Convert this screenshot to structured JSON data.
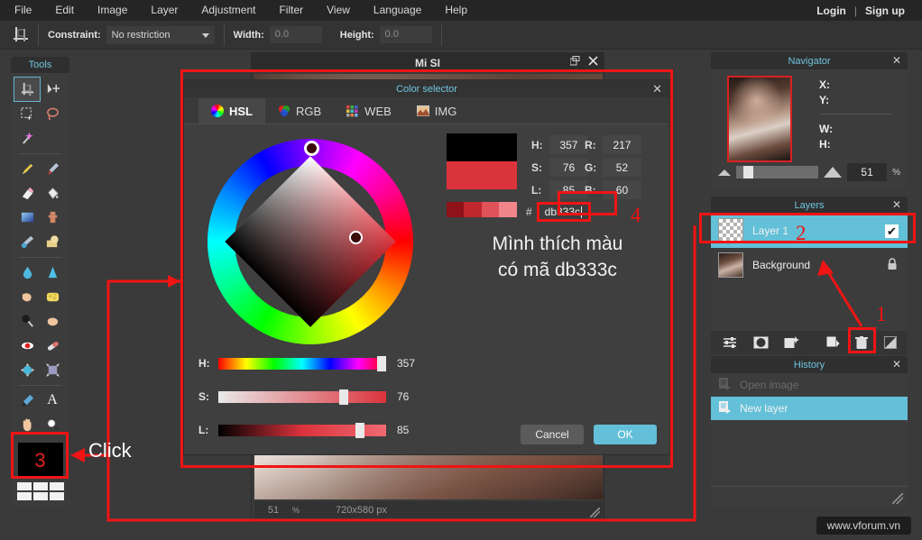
{
  "menubar": {
    "items": [
      "File",
      "Edit",
      "Image",
      "Layer",
      "Adjustment",
      "Filter",
      "View",
      "Language",
      "Help"
    ],
    "account": {
      "login": "Login",
      "separator": "|",
      "signup": "Sign up"
    }
  },
  "options_bar": {
    "tool_icon": "crop-tool-icon",
    "constraint_label": "Constraint:",
    "constraint_value": "No restriction",
    "width_label": "Width:",
    "width_value": "0.0",
    "height_label": "Height:",
    "height_value": "0.0"
  },
  "tools": {
    "title": "Tools",
    "items": [
      {
        "name": "crop-tool",
        "glyph": "⌗",
        "selected": true
      },
      {
        "name": "move-tool",
        "glyph": "✣",
        "selected": false
      },
      {
        "name": "marquee-select-tool",
        "glyph": "⬚",
        "selected": false
      },
      {
        "name": "lasso-select-tool",
        "glyph": "◯",
        "selected": false
      },
      {
        "name": "magic-wand-tool",
        "glyph": "✨",
        "selected": false
      },
      {
        "name": "pencil-tool",
        "glyph": "✎",
        "selected": false
      },
      {
        "name": "brush-tool",
        "glyph": "✒",
        "selected": false
      },
      {
        "name": "eraser-tool",
        "glyph": "▭",
        "selected": false
      },
      {
        "name": "paint-bucket-tool",
        "glyph": "⬣",
        "selected": false
      },
      {
        "name": "gradient-tool",
        "glyph": "■",
        "selected": false
      },
      {
        "name": "clone-stamp-tool",
        "glyph": "♟",
        "selected": false
      },
      {
        "name": "replace-color-tool",
        "glyph": "⚒",
        "selected": false
      },
      {
        "name": "drawing-shape-tool",
        "glyph": "⬟",
        "selected": false
      },
      {
        "name": "blur-tool",
        "glyph": "💧",
        "selected": false
      },
      {
        "name": "sharpen-tool",
        "glyph": "▲",
        "selected": false
      },
      {
        "name": "smudge-tool",
        "glyph": "☛",
        "selected": false
      },
      {
        "name": "sponge-tool",
        "glyph": "▧",
        "selected": false
      },
      {
        "name": "burn-tool",
        "glyph": "⚫",
        "selected": false
      },
      {
        "name": "dodge-tool",
        "glyph": "☚",
        "selected": false
      },
      {
        "name": "red-eye-tool",
        "glyph": "◉",
        "selected": false
      },
      {
        "name": "spot-heal-tool",
        "glyph": "⚗",
        "selected": false
      },
      {
        "name": "bloat-tool",
        "glyph": "⬤",
        "selected": false
      },
      {
        "name": "pinch-tool",
        "glyph": "◆",
        "selected": false
      },
      {
        "name": "eyedropper-tool",
        "glyph": "✒",
        "selected": false
      },
      {
        "name": "type-tool",
        "glyph": "A",
        "selected": false
      },
      {
        "name": "hand-tool",
        "glyph": "✋",
        "selected": false
      },
      {
        "name": "zoom-tool",
        "glyph": "🔍",
        "selected": false
      }
    ],
    "swatch_marker": "3"
  },
  "document_window": {
    "title": "Mi SI",
    "restore_icon": "restore-window-icon",
    "close_icon": "close-window-icon",
    "status_zoom": "51",
    "status_percent": "%",
    "status_dimensions": "720x580 px"
  },
  "color_selector": {
    "title": "Color selector",
    "close_icon": "close-icon",
    "tabs": [
      {
        "label": "HSL",
        "icon": "color-wheel-icon",
        "active": true
      },
      {
        "label": "RGB",
        "icon": "rgb-circles-icon",
        "active": false
      },
      {
        "label": "WEB",
        "icon": "web-palette-icon",
        "active": false
      },
      {
        "label": "IMG",
        "icon": "image-picker-icon",
        "active": false
      }
    ],
    "sliders": [
      {
        "label": "H:",
        "value": "357",
        "knob_pct": 99
      },
      {
        "label": "S:",
        "value": "76",
        "knob_pct": 76
      },
      {
        "label": "L:",
        "value": "85",
        "knob_pct": 85
      }
    ],
    "hsl_fields": [
      {
        "label": "H:",
        "value": "357"
      },
      {
        "label": "S:",
        "value": "76"
      },
      {
        "label": "L:",
        "value": "85"
      }
    ],
    "rgb_fields": [
      {
        "label": "R:",
        "value": "217"
      },
      {
        "label": "G:",
        "value": "52"
      },
      {
        "label": "B:",
        "value": "60"
      }
    ],
    "hash_symbol": "#",
    "hex_value": "db333c",
    "note_line1": "Mình thích màu",
    "note_line2": "có mã db333c",
    "cancel_label": "Cancel",
    "ok_label": "OK",
    "selected_color": "#db333c",
    "previous_color": "#000000",
    "recent_colors": [
      "#8e1218",
      "#c0272e",
      "#e0525a",
      "#f0868c"
    ]
  },
  "navigator": {
    "title": "Navigator",
    "close_icon": "close-icon",
    "fields": [
      {
        "label": "X:",
        "value": ""
      },
      {
        "label": "Y:",
        "value": ""
      },
      {
        "label": "W:",
        "value": ""
      },
      {
        "label": "H:",
        "value": ""
      }
    ],
    "zoom_out_icon": "zoom-out-triangle-icon",
    "zoom_in_icon": "zoom-in-triangle-icon",
    "zoom_value": "51",
    "zoom_unit": "%"
  },
  "layers": {
    "title": "Layers",
    "close_icon": "close-icon",
    "rows": [
      {
        "name": "Layer 1",
        "selected": true,
        "visible_check": "✔",
        "locked": false,
        "thumb": "alpha"
      },
      {
        "name": "Background",
        "selected": false,
        "locked": true,
        "lock_icon": "🔒",
        "thumb": "photo"
      }
    ],
    "toolbar": [
      {
        "name": "layer-settings-icon",
        "glyph": "☲"
      },
      {
        "name": "layer-mask-icon",
        "glyph": "◉"
      },
      {
        "name": "layer-style-icon",
        "glyph": "✦"
      },
      {
        "name": "add-layer-icon",
        "glyph": "❐"
      },
      {
        "name": "delete-layer-icon",
        "glyph": "🗑"
      },
      {
        "name": "layer-blend-icon",
        "glyph": "◩"
      }
    ]
  },
  "history": {
    "title": "History",
    "close_icon": "close-icon",
    "rows": [
      {
        "label": "Open image",
        "selected": false,
        "icon": "history-doc-icon"
      },
      {
        "label": "New layer",
        "selected": true,
        "icon": "history-doc-icon"
      }
    ]
  },
  "annotations": {
    "markers": [
      {
        "id": "1",
        "target": "add-layer-button"
      },
      {
        "id": "2",
        "target": "layer-1-row"
      },
      {
        "id": "3",
        "target": "foreground-color-swatch"
      },
      {
        "id": "4",
        "target": "hex-input"
      }
    ],
    "click_label": "Click",
    "highlight_color": "#f01414"
  },
  "watermark": "www.vforum.vn"
}
